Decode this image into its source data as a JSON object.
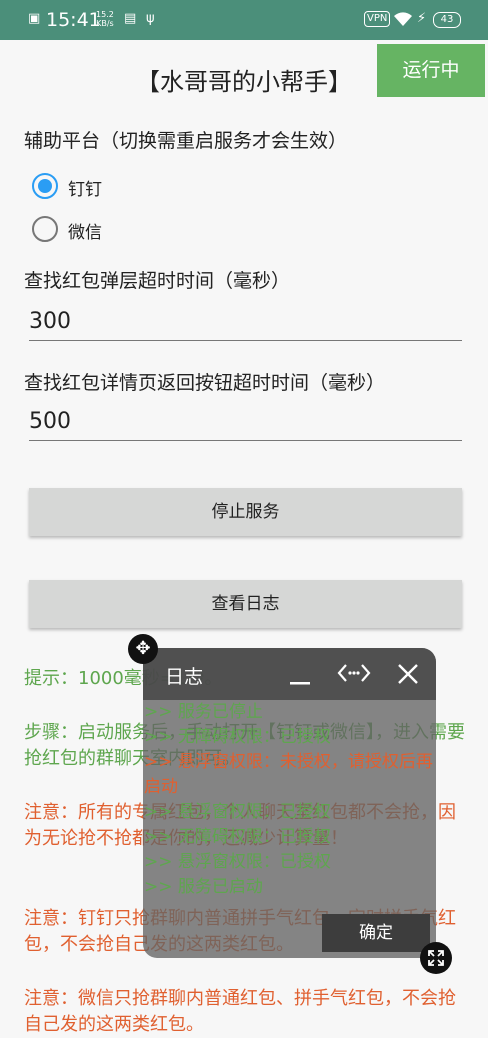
{
  "statusbar": {
    "time": "15:41",
    "speed_value": "15.2",
    "speed_unit": "KB/s",
    "vpn": "VPN",
    "battery": "43"
  },
  "header": {
    "title": "【水哥哥的小帮手】",
    "status_badge": "运行中"
  },
  "settings": {
    "platform_label": "辅助平台（切换需重启服务才会生效）",
    "platforms": [
      {
        "label": "钉钉",
        "selected": true
      },
      {
        "label": "微信",
        "selected": false
      }
    ],
    "popup_timeout_label": "查找红包弹层超时时间（毫秒）",
    "popup_timeout_value": "300",
    "detail_timeout_label": "查找红包详情页返回按钮超时时间（毫秒）",
    "detail_timeout_value": "500"
  },
  "buttons": {
    "stop_service": "停止服务",
    "view_log": "查看日志"
  },
  "tips": [
    {
      "text": "提示：1000毫秒=1秒。",
      "color": "green"
    },
    {
      "text": "步骤：启动服务后，手动打开【钉钉或微信】，进入需要抢红包的群聊天室内即可。",
      "color": "green"
    },
    {
      "text": "注意：所有的专属红包，个人聊天室红包都不会抢，因为无论抢不抢都是你的，还减少计算量！",
      "color": "red"
    },
    {
      "text": "注意：钉钉只抢群聊内普通拼手气红包、定时拼手气红包，不会抢自己发的这两类红包。",
      "color": "red"
    },
    {
      "text": "注意：微信只抢群聊内普通红包、拼手气红包，不会抢自己发的这两类红包。",
      "color": "red"
    }
  ],
  "log_window": {
    "title": "日志",
    "icons": {
      "minimize": "minimize-icon",
      "expand": "expand-horizontal-icon",
      "close": "close-icon",
      "move": "move-icon",
      "resize": "resize-icon"
    },
    "lines": [
      {
        "text": ">> 服务已停止",
        "color": "green"
      },
      {
        "text": ">> 无障碍权限：已授权",
        "color": "green"
      },
      {
        "text": ">> 悬浮窗权限：未授权，请授权后再启动",
        "color": "red"
      },
      {
        "text": ">> 悬浮窗权限：已授权",
        "color": "green"
      },
      {
        "text": ">> 无障碍权限：已授权",
        "color": "green"
      },
      {
        "text": ">> 悬浮窗权限：已授权",
        "color": "green"
      },
      {
        "text": ">> 服务已启动",
        "color": "green"
      }
    ],
    "ok_button": "确定"
  },
  "colors": {
    "statusbar": "#4b8f7a",
    "badge": "#66b463",
    "radio_on": "#2a9df4",
    "tip_green": "#5ea64e",
    "tip_red": "#e06030"
  }
}
